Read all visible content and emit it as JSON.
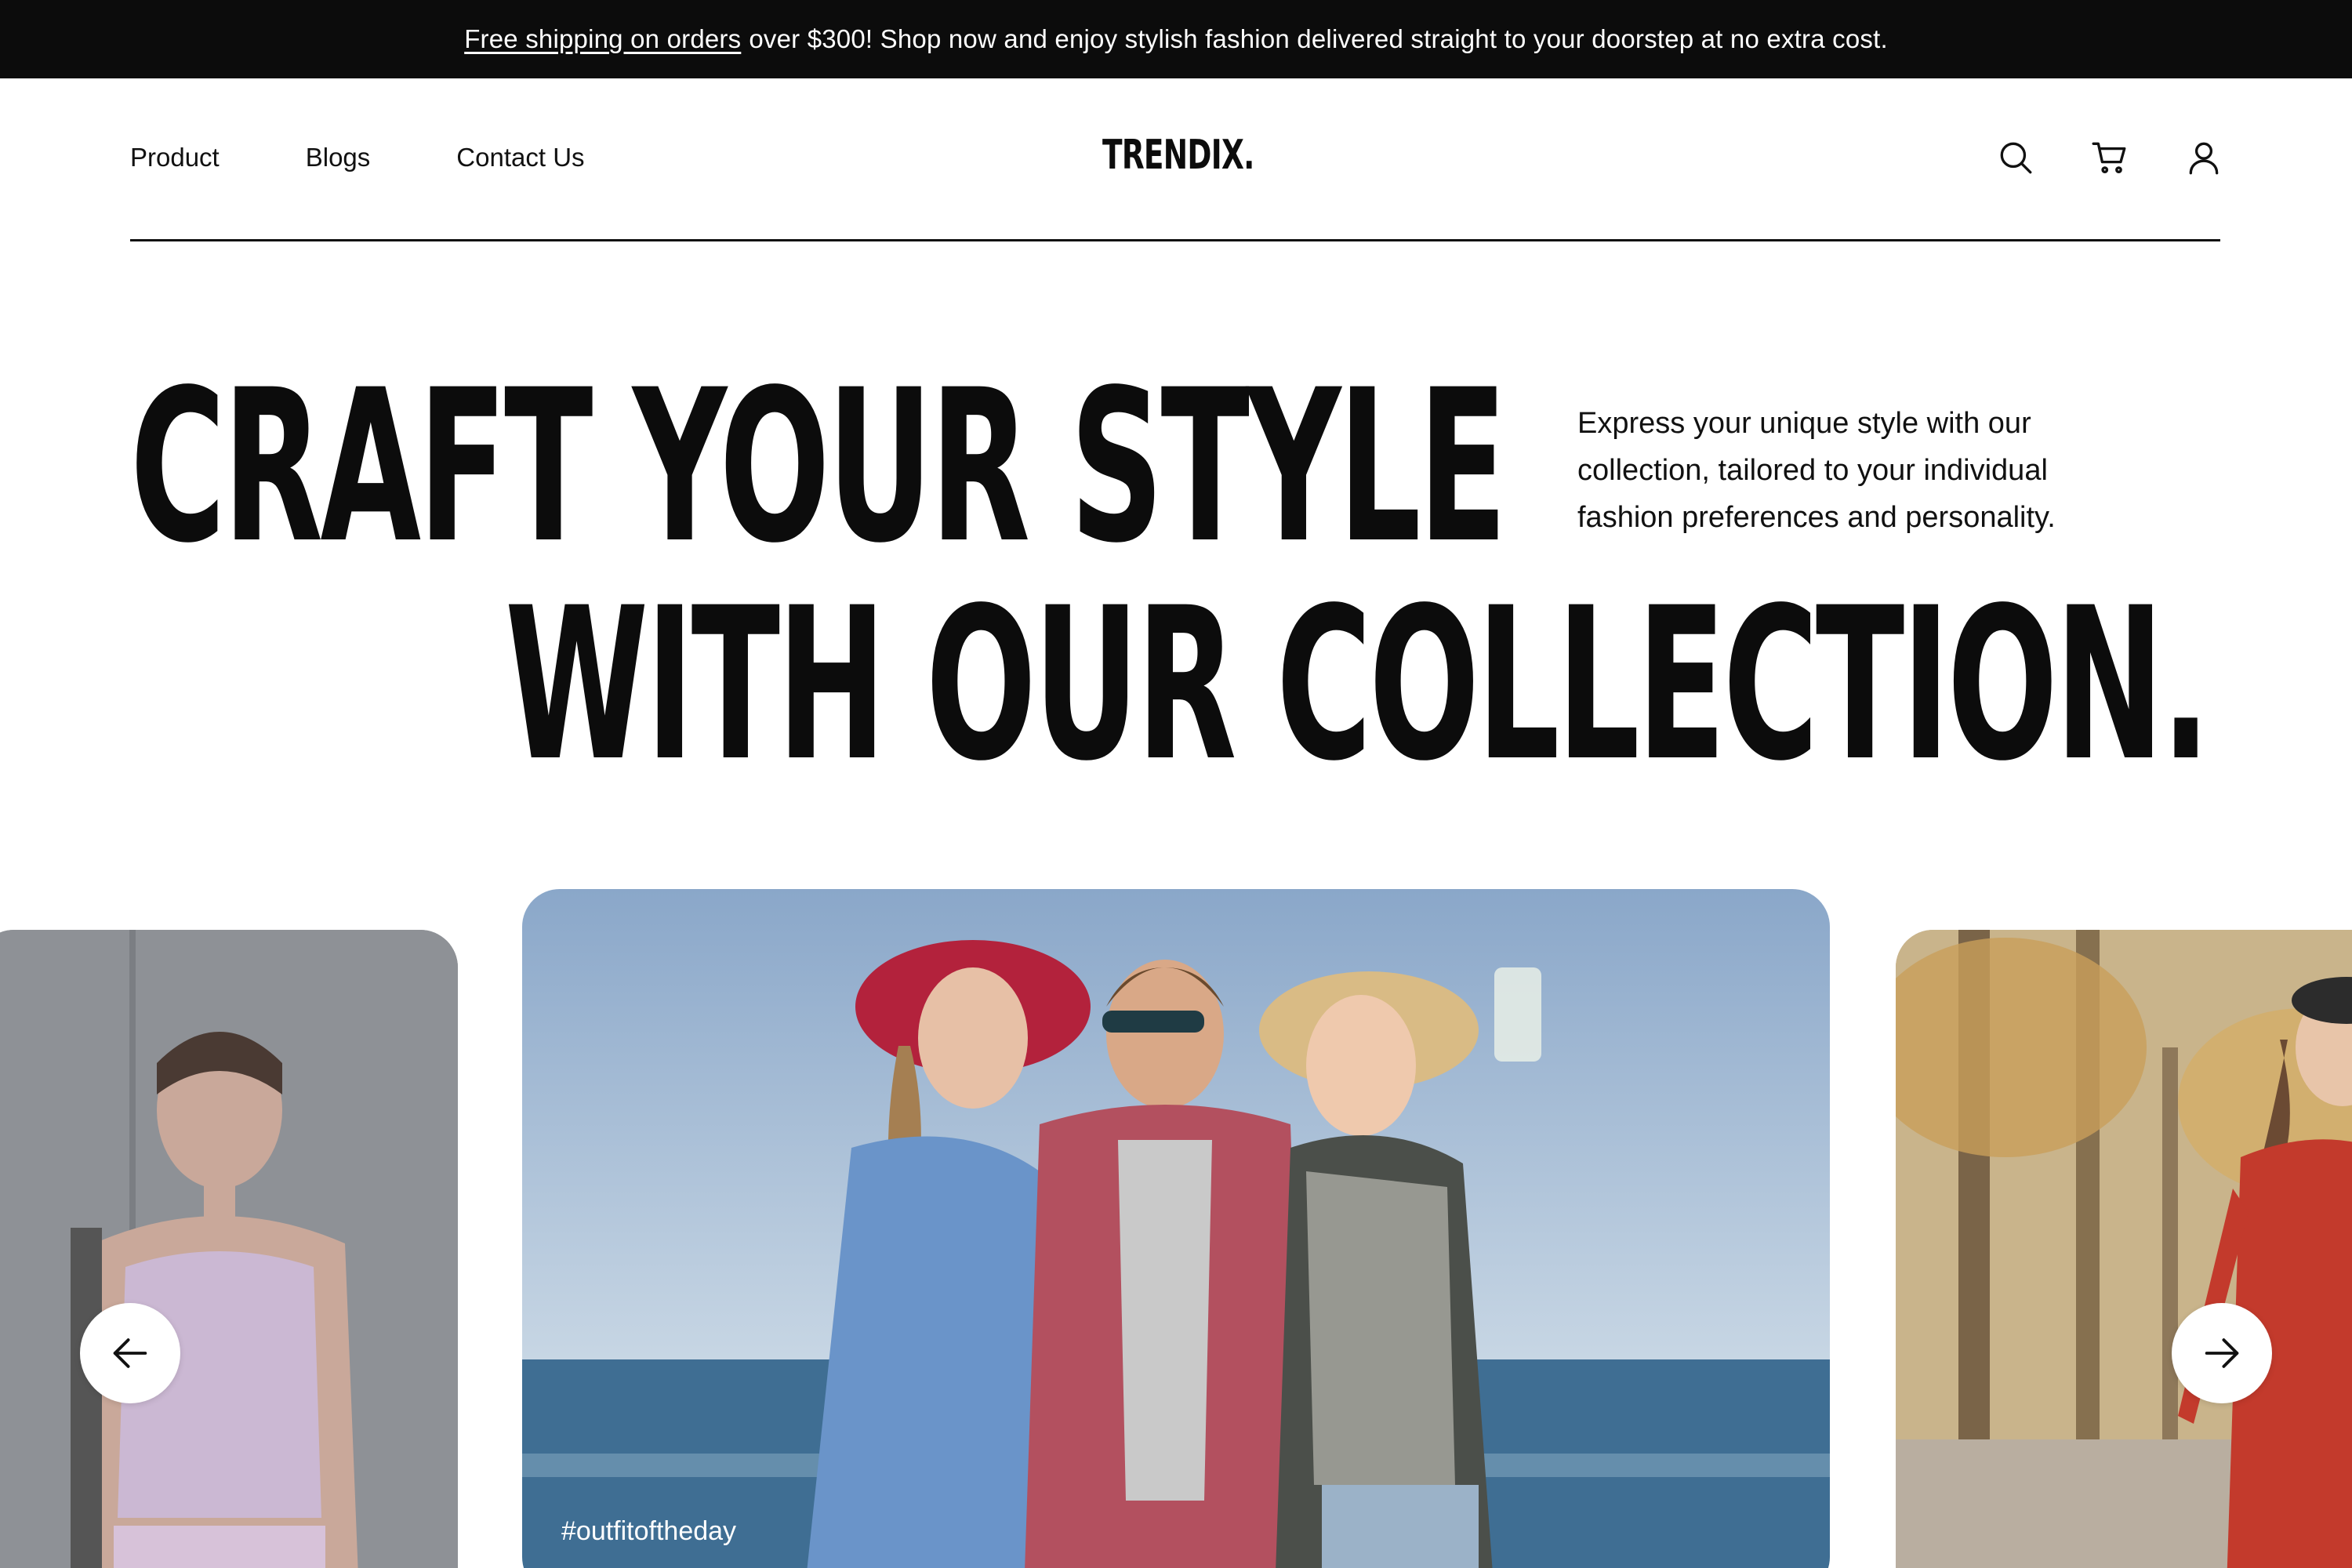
{
  "announcement": {
    "link_text": "Free shipping on orders",
    "text": "over $300! Shop now and enjoy stylish fashion delivered straight to your doorstep at no extra cost."
  },
  "nav": {
    "items": [
      "Product",
      "Blogs",
      "Contact Us"
    ]
  },
  "brand": {
    "logo": "TRENDIX."
  },
  "header_icons": [
    "search-icon",
    "cart-icon",
    "user-icon"
  ],
  "hero": {
    "line1": "CRAFT YOUR STYLE",
    "line2": "WITH OUR COLLECTION.",
    "subtitle": "Express your unique style with our collection, tailored to your individual fashion preferences and personality."
  },
  "carousel": {
    "center_tag": "#outfitoftheday",
    "prev_icon": "arrow-left-icon",
    "next_icon": "arrow-right-icon"
  },
  "colors": {
    "topbar_bg": "#0c0c0c",
    "text": "#111111",
    "background": "#ffffff"
  }
}
